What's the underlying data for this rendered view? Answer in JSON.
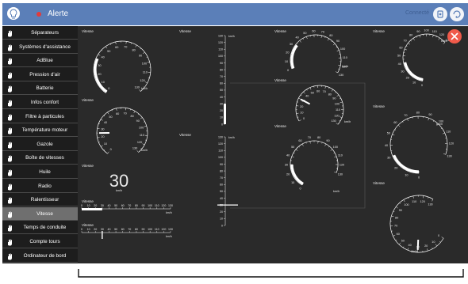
{
  "header": {
    "title": "Alerte",
    "status_text": "Connecté",
    "accent_color": "#5b7fb8",
    "alert_color": "#e23b3b",
    "icons": [
      "lightbulb-icon",
      "record-icon",
      "menu-icon"
    ]
  },
  "sidebar": {
    "items": [
      {
        "label": "Séparateurs"
      },
      {
        "label": "Systèmes d'assistance"
      },
      {
        "label": "AdBlue"
      },
      {
        "label": "Pression d'air"
      },
      {
        "label": "Batterie"
      },
      {
        "label": "Infos confort"
      },
      {
        "label": "Filtre à particules"
      },
      {
        "label": "Température moteur"
      },
      {
        "label": "Gazole"
      },
      {
        "label": "Boîte de vitesses"
      },
      {
        "label": "Huile"
      },
      {
        "label": "Radio"
      },
      {
        "label": "Ralentisseur"
      },
      {
        "label": "Vitesse"
      },
      {
        "label": "Temps de conduite"
      },
      {
        "label": "Compte tours"
      },
      {
        "label": "Ordinateur de bord"
      }
    ],
    "active": "Vitesse",
    "item_icon": "hand-icon"
  },
  "main": {
    "widget_title": "Vitesse",
    "unit": "km/h",
    "digital_value": "30",
    "close_icon": "close-icon",
    "close_color": "#f05a4a",
    "gauge_max": 130,
    "widgets": [
      {
        "kind": "gauge",
        "style": "bottom-left",
        "value": 36
      },
      {
        "kind": "gauge",
        "style": "bottom-left",
        "value": 25
      },
      {
        "kind": "digital",
        "value": 30
      },
      {
        "kind": "hbar",
        "value": 30
      },
      {
        "kind": "hbar-needle",
        "value": 30
      },
      {
        "kind": "vbar",
        "value": 30
      },
      {
        "kind": "vbar-needle",
        "value": 30
      },
      {
        "kind": "gauge",
        "style": "top-arc",
        "value": 33
      },
      {
        "kind": "gauge",
        "style": "needle-left",
        "value": 30
      },
      {
        "kind": "gauge",
        "style": "bottom-arc",
        "value": 30
      },
      {
        "kind": "gauge",
        "style": "right-arc",
        "value": 40
      },
      {
        "kind": "gauge",
        "style": "needle-bottom-left",
        "value": 30
      },
      {
        "kind": "gauge",
        "style": "right-arc-thick",
        "value": 30
      },
      {
        "kind": "gauge",
        "style": "needle-bottom",
        "value": 30
      }
    ],
    "hbar_ticks": [
      "0",
      "10",
      "20",
      "30",
      "40",
      "50",
      "60",
      "70",
      "80",
      "90",
      "100",
      "110",
      "120",
      "130"
    ],
    "vbar_ticks": [
      "130",
      "120",
      "110",
      "100",
      "90",
      "80",
      "70",
      "60",
      "50",
      "40",
      "30",
      "20",
      "10",
      "0"
    ],
    "gauge_ticks": [
      "0",
      "10",
      "20",
      "30",
      "40",
      "50",
      "60",
      "70",
      "80",
      "90",
      "100",
      "110",
      "120",
      "130"
    ]
  }
}
